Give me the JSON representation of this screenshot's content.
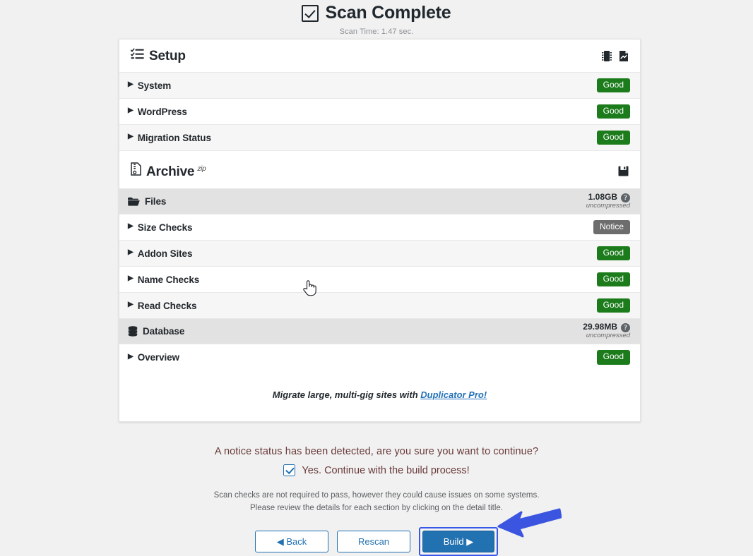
{
  "header": {
    "title": "Scan Complete",
    "subtitle": "Scan Time: 1.47 sec.",
    "check_icon": "checkbox-checked-icon"
  },
  "setup": {
    "title": "Setup",
    "icon": "tasks-list-icon",
    "actions": [
      {
        "name": "server-chip-icon",
        "label": "Server Settings"
      },
      {
        "name": "file-export-icon",
        "label": "Export"
      }
    ],
    "rows": [
      {
        "label": "System",
        "status": "Good",
        "status_type": "good"
      },
      {
        "label": "WordPress",
        "status": "Good",
        "status_type": "good"
      },
      {
        "label": "Migration Status",
        "status": "Good",
        "status_type": "good"
      }
    ]
  },
  "archive": {
    "title": "Archive",
    "superscript": "zip",
    "icon": "archive-file-icon",
    "actions": [
      {
        "name": "save-disk-icon",
        "label": "Save"
      }
    ],
    "groups": [
      {
        "label": "Files",
        "icon": "folder-icon",
        "size": "1.08GB",
        "size_note": "uncompressed",
        "help_icon": "help-circle-icon",
        "rows": [
          {
            "label": "Size Checks",
            "status": "Notice",
            "status_type": "notice"
          },
          {
            "label": "Addon Sites",
            "status": "Good",
            "status_type": "good"
          },
          {
            "label": "Name Checks",
            "status": "Good",
            "status_type": "good"
          },
          {
            "label": "Read Checks",
            "status": "Good",
            "status_type": "good"
          }
        ]
      },
      {
        "label": "Database",
        "icon": "database-icon",
        "size": "29.98MB",
        "size_note": "uncompressed",
        "help_icon": "help-circle-icon",
        "rows": [
          {
            "label": "Overview",
            "status": "Good",
            "status_type": "good"
          }
        ]
      }
    ]
  },
  "promo": {
    "text": "Migrate large, multi-gig sites with ",
    "link": "Duplicator Pro!"
  },
  "footer": {
    "notice_question": "A notice status has been detected, are you sure you want to continue?",
    "confirm_label": "Yes. Continue with the build process!",
    "confirm_checked": true,
    "fineprint_line1": "Scan checks are not required to pass, however they could cause issues on some systems.",
    "fineprint_line2": "Please review the details for each section by clicking on the detail title.",
    "buttons": {
      "back": "◀ Back",
      "rescan": "Rescan",
      "build": "Build ▶"
    }
  },
  "annotations": {
    "arrow": "arrow-pointing-left-to-build-button",
    "cursor": "pointer-hand-cursor"
  },
  "colors": {
    "good": "#1c7c1c",
    "notice": "#6d6d6d",
    "primary": "#2271b1",
    "focus_ring": "#3858e9",
    "arrow": "#3b55e0",
    "notice_text": "#6a3a3a"
  }
}
